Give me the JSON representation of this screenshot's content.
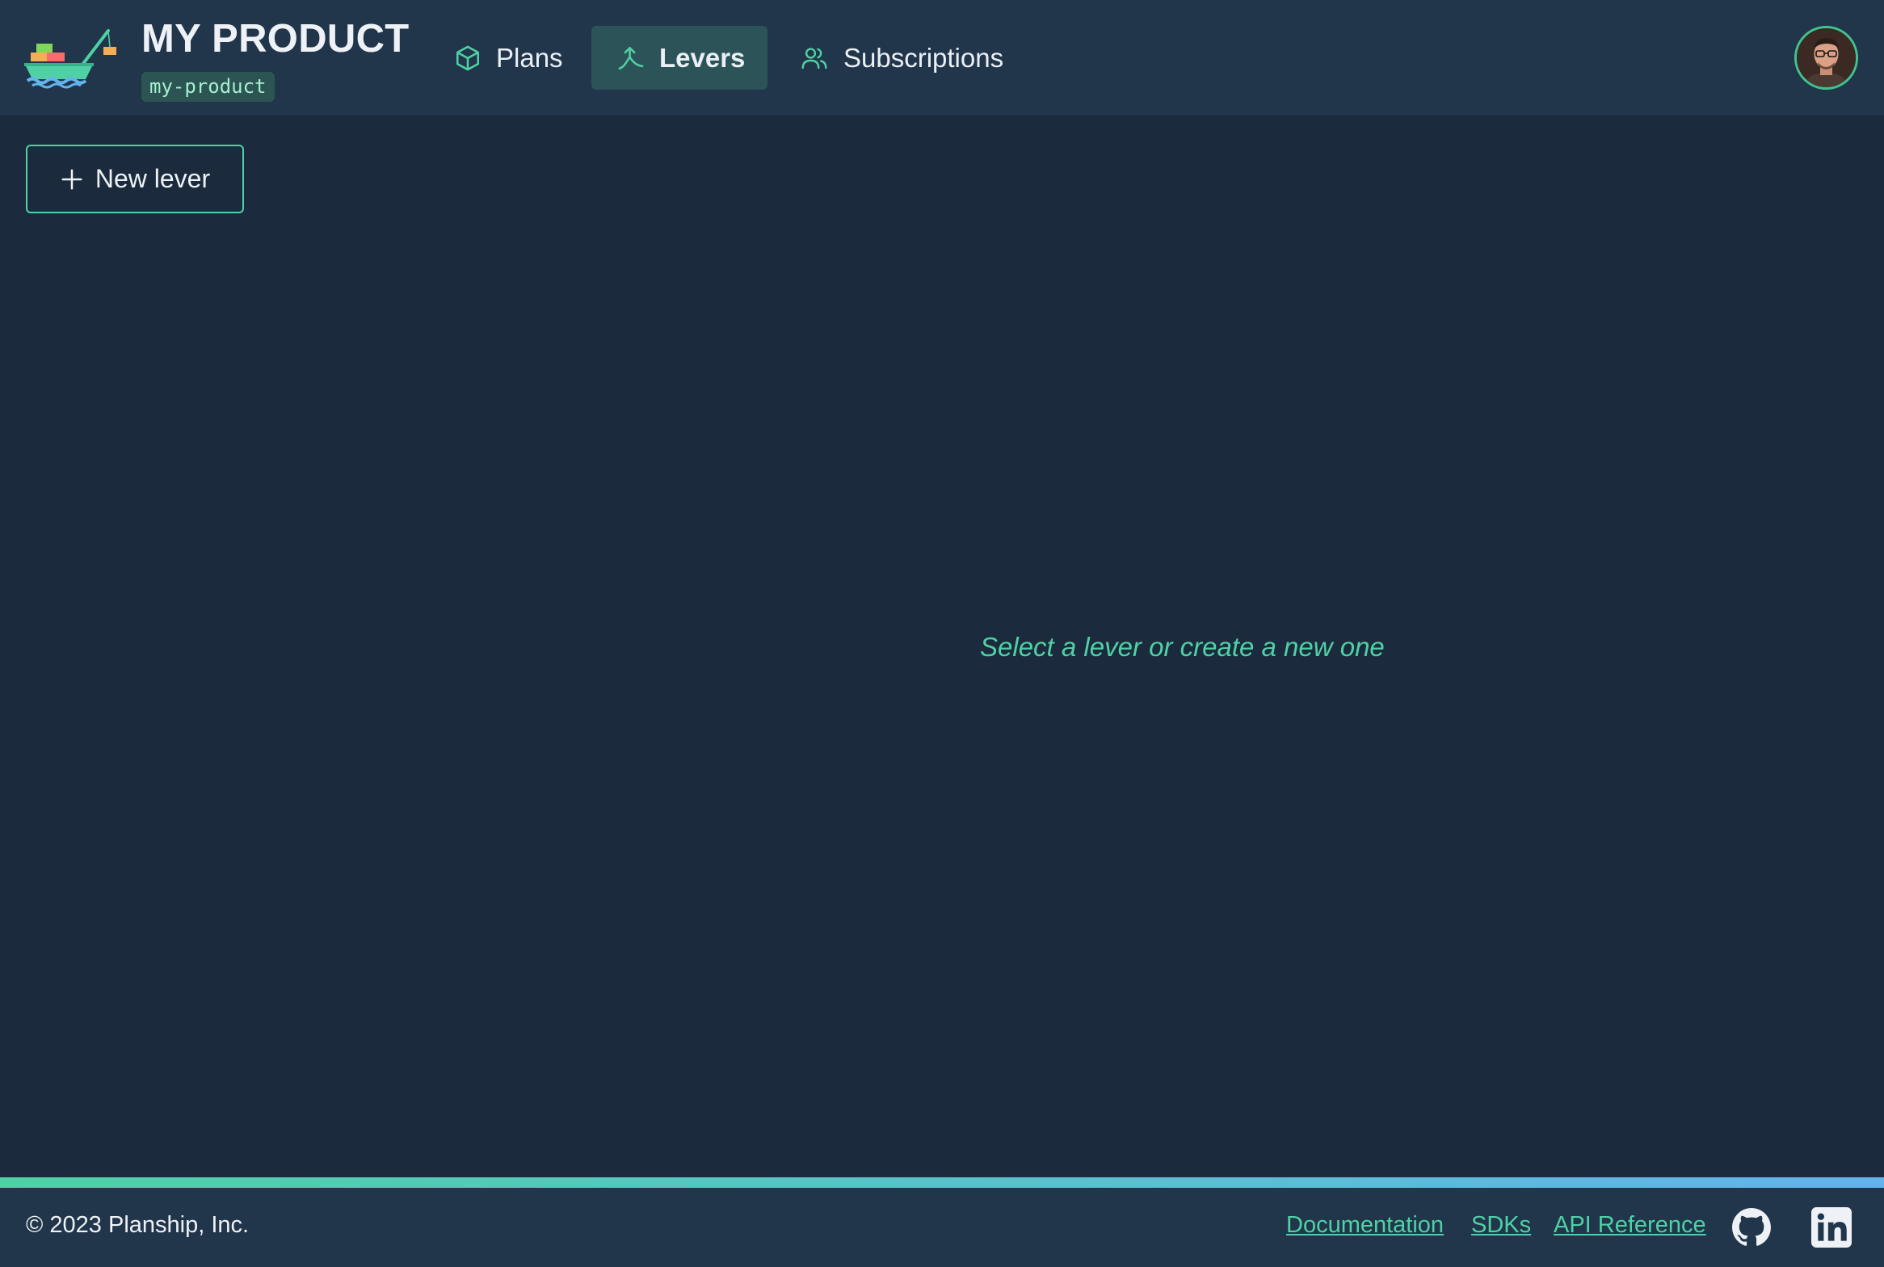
{
  "header": {
    "brand_title": "MY PRODUCT",
    "slug": "my-product",
    "logo_icon": "ship-logo-icon",
    "tabs": [
      {
        "label": "Plans",
        "icon": "cube-icon",
        "active": false
      },
      {
        "label": "Levers",
        "icon": "lever-icon",
        "active": true
      },
      {
        "label": "Subscriptions",
        "icon": "users-icon",
        "active": false
      }
    ],
    "avatar_icon": "user-avatar"
  },
  "main": {
    "new_lever_label": "New lever",
    "empty_message": "Select a lever or create a new one"
  },
  "footer": {
    "copyright": "© 2023 Planship, Inc.",
    "links": [
      "Documentation",
      "SDKs",
      "API Reference"
    ],
    "social_icons": [
      "github-icon",
      "linkedin-icon"
    ]
  },
  "colors": {
    "background": "#1b2a3d",
    "header": "#21354b",
    "accent": "#4fd1a5",
    "active_tab": "#2c5357",
    "gradient_end": "#63b3ed"
  }
}
